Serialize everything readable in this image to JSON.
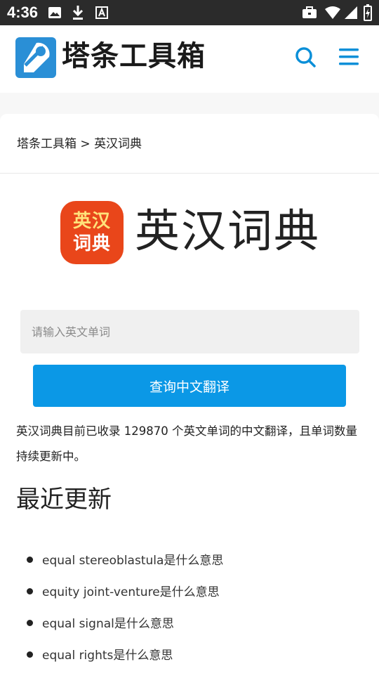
{
  "status_bar": {
    "time": "4:36",
    "icons_left": [
      "image-icon",
      "download-icon",
      "font-a-icon"
    ],
    "icons_right": [
      "briefcase-icon",
      "wifi-icon",
      "cell-signal-icon",
      "battery-charging-icon"
    ]
  },
  "header": {
    "logo_text": "塔条工具箱",
    "actions": [
      "search-icon",
      "menu-icon"
    ],
    "accent_color": "#0b8fd8"
  },
  "breadcrumb": {
    "home": "塔条工具箱",
    "separator": ">",
    "current": "英汉词典"
  },
  "app": {
    "icon_line1": "英汉",
    "icon_line2": "词典",
    "icon_color": "#e9461a",
    "title": "英汉词典"
  },
  "search": {
    "placeholder": "请输入英文单词",
    "value": "",
    "button_label": "查询中文翻译",
    "button_color": "#0b98e6"
  },
  "description": "英汉词典目前已收录 129870 个英文单词的中文翻译，且单词数量持续更新中。",
  "recent": {
    "title": "最近更新",
    "items": [
      "equal stereoblastula是什么意思",
      "equity joint-venture是什么意思",
      "equal signal是什么意思",
      "equal rights是什么意思"
    ]
  }
}
